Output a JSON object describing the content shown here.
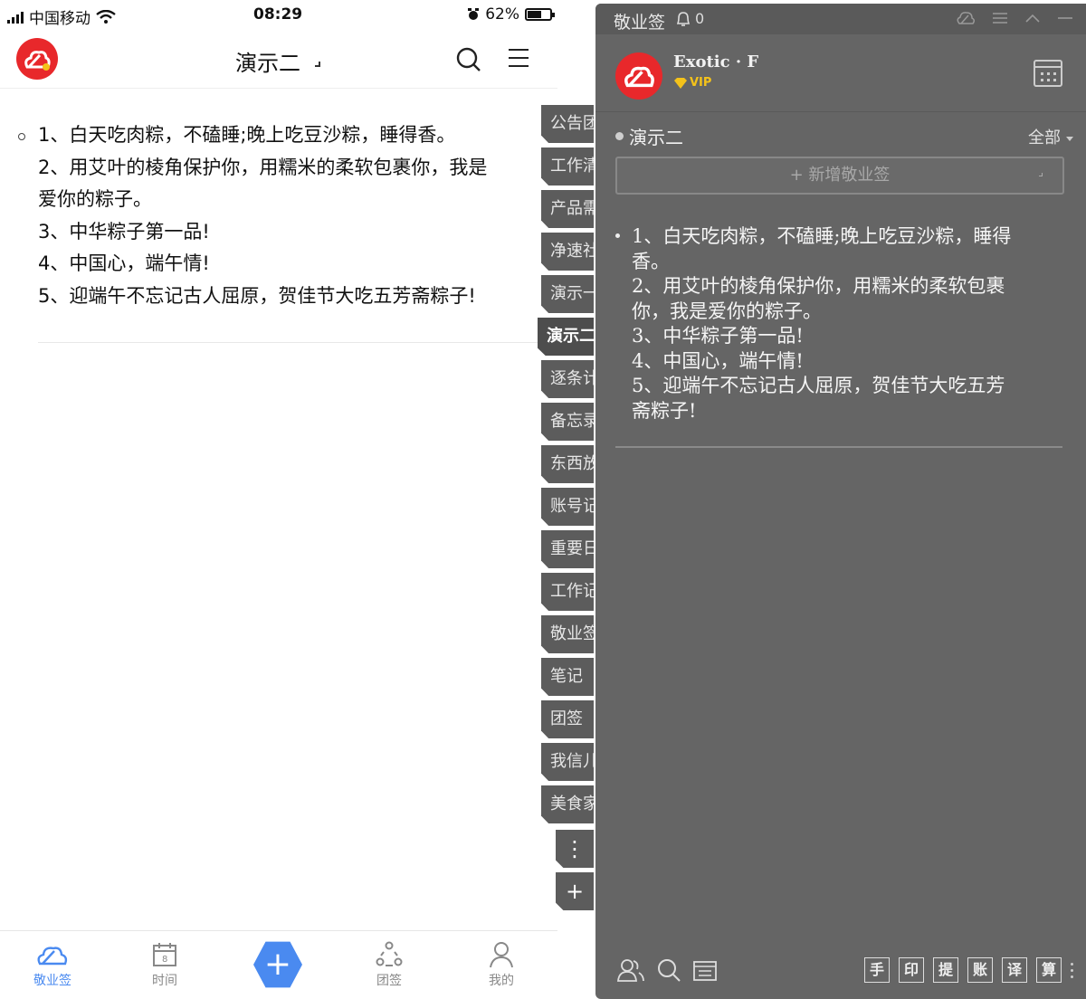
{
  "phone": {
    "status": {
      "carrier": "中国移动",
      "time": "08:29",
      "battery": "62%",
      "battery_level": 0.62
    },
    "header": {
      "title": "演示二"
    },
    "note_lines": [
      "1、白天吃肉粽，不磕睡;晚上吃豆沙粽，睡得香。",
      "2、用艾叶的棱角保护你，用糯米的柔软包裹你，我是",
      "爱你的粽子。",
      "3、中华粽子第一品!",
      "4、中国心，端午情!",
      "5、迎端午不忘记古人屈原，贺佳节大吃五芳斋粽子!"
    ],
    "tabbar": {
      "tabs": [
        {
          "label": "敬业签",
          "icon": "cloud-logo-icon",
          "active": true
        },
        {
          "label": "时间",
          "icon": "calendar-icon",
          "active": false
        },
        {
          "label": "团签",
          "icon": "team-icon",
          "active": false
        },
        {
          "label": "我的",
          "icon": "person-icon",
          "active": false
        }
      ],
      "fab_label": "+"
    },
    "accent_color": "#4a8af0"
  },
  "side_tabs": [
    "公告团",
    "工作清",
    "产品需",
    "净速社",
    "演示一",
    "演示二",
    "逐条计",
    "备忘录",
    "东西放",
    "账号记",
    "重要日",
    "工作记",
    "敬业签",
    "笔记",
    "团签",
    "我信儿",
    "美食家"
  ],
  "side_tabs_active": "演示二",
  "side_buttons": {
    "more": "⋮",
    "add": "+"
  },
  "widget": {
    "app_name": "敬业签",
    "notification_count": "0",
    "user": {
      "name": "Exotic · F",
      "badge": "VIP"
    },
    "category": "演示二",
    "filter": "全部",
    "new_note_label": "+ 新增敬业签",
    "note_lines": [
      "1、白天吃肉粽，不磕睡;晚上吃豆沙粽，睡得",
      "香。",
      "2、用艾叶的棱角保护你，用糯米的柔软包裹",
      "你，我是爱你的粽子。",
      "3、中华粽子第一品!",
      "4、中国心，端午情!",
      "5、迎端午不忘记古人屈原，贺佳节大吃五芳",
      "斋粽子!"
    ],
    "toolbar_buttons": [
      "手",
      "印",
      "提",
      "账",
      "译",
      "算"
    ],
    "bg_color": "#656565",
    "vip_color": "#f4c21a",
    "logo_color": "#e8282b"
  }
}
